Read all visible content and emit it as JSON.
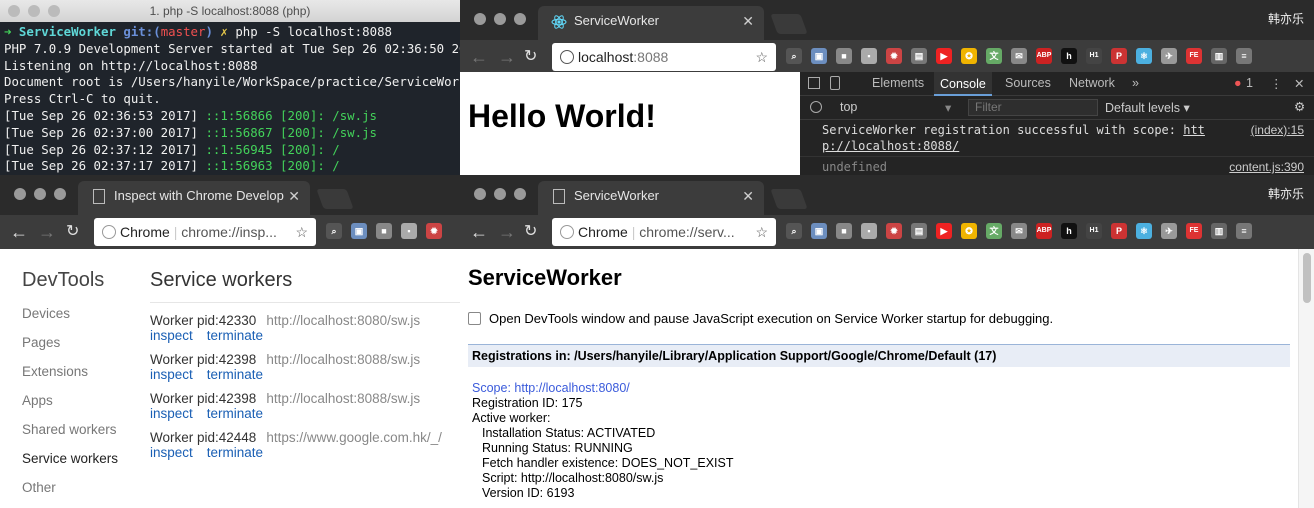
{
  "terminal": {
    "title": "1. php -S localhost:8088 (php)",
    "prompt_dir": "ServiceWorker",
    "prompt_git": "git:(",
    "prompt_branch": "master",
    "prompt_close": ")",
    "prompt_x": "✗",
    "command": "php -S localhost:8088",
    "lines": [
      "PHP 7.0.9 Development Server started at Tue Sep 26 02:36:50 2017",
      "Listening on http://localhost:8088",
      "Document root is /Users/hanyile/WorkSpace/practice/ServiceWorker",
      "Press Ctrl-C to quit."
    ],
    "log": [
      {
        "time": "[Tue Sep 26 02:36:53 2017]",
        "msg": "::1:56866 [200]: /sw.js"
      },
      {
        "time": "[Tue Sep 26 02:37:00 2017]",
        "msg": "::1:56867 [200]: /sw.js"
      },
      {
        "time": "[Tue Sep 26 02:37:12 2017]",
        "msg": "::1:56945 [200]: /"
      },
      {
        "time": "[Tue Sep 26 02:37:17 2017]",
        "msg": "::1:56963 [200]: /"
      }
    ]
  },
  "user_name": "韩亦乐",
  "win_top": {
    "tab_title": "ServiceWorker",
    "url_host": "localhost",
    "url_port": ":8088",
    "page_heading": "Hello World!",
    "devtools": {
      "tabs": [
        "Elements",
        "Console",
        "Sources",
        "Network"
      ],
      "more": "»",
      "error_count": "1",
      "context": "top",
      "filter_placeholder": "Filter",
      "levels": "Default levels ▾",
      "msg1_a": "ServiceWorker registration successful with scope: ",
      "msg1_link_a": "htt",
      "msg1_src": "(index):15",
      "msg1_link_b": "p://localhost:8088/",
      "msg2": "undefined",
      "msg2_src": "content.js:390"
    }
  },
  "win_bl": {
    "tab_title": "Inspect with Chrome Develope",
    "url_scheme": "Chrome",
    "url_text": "chrome://insp...",
    "nav_title": "DevTools",
    "nav": [
      "Devices",
      "Pages",
      "Extensions",
      "Apps",
      "Shared workers",
      "Service workers",
      "Other"
    ],
    "nav_selected": "Service workers",
    "section_title": "Service workers",
    "workers": [
      {
        "pid": "Worker pid:42330",
        "url": "http://localhost:8080/sw.js"
      },
      {
        "pid": "Worker pid:42398",
        "url": "http://localhost:8088/sw.js"
      },
      {
        "pid": "Worker pid:42398",
        "url": "http://localhost:8088/sw.js"
      },
      {
        "pid": "Worker pid:42448",
        "url": "https://www.google.com.hk/_/"
      }
    ],
    "inspect_label": "inspect",
    "terminate_label": "terminate"
  },
  "win_br": {
    "tab_title": "ServiceWorker",
    "url_scheme": "Chrome",
    "url_text": "chrome://serv...",
    "heading": "ServiceWorker",
    "checkbox_label": "Open DevTools window and pause JavaScript execution on Service Worker startup for debugging.",
    "reg_heading": "Registrations in: /Users/hanyile/Library/Application Support/Google/Chrome/Default (17)",
    "scope": "Scope: http://localhost:8080/",
    "reg_id": "Registration ID: 175",
    "active": "Active worker:",
    "install": "Installation Status: ACTIVATED",
    "running": "Running Status: RUNNING",
    "fetch": "Fetch handler existence: DOES_NOT_EXIST",
    "script": "Script: http://localhost:8080/sw.js",
    "version": "Version ID: 6193"
  },
  "extension_icons": [
    "search-ext-icon",
    "photo-ext-icon",
    "square-ext-icon",
    "save-ext-icon",
    "bug-ext-icon",
    "image-ext-icon",
    "youtube-ext-icon",
    "compass-ext-icon",
    "translate-ext-icon",
    "mail-ext-icon",
    "adblock-ext-icon",
    "hacker-ext-icon",
    "h1-ext-icon",
    "pinterest-ext-icon",
    "react-ext-icon",
    "bird-ext-icon",
    "fe-ext-icon",
    "layout-ext-icon",
    "menu-ext-icon"
  ]
}
